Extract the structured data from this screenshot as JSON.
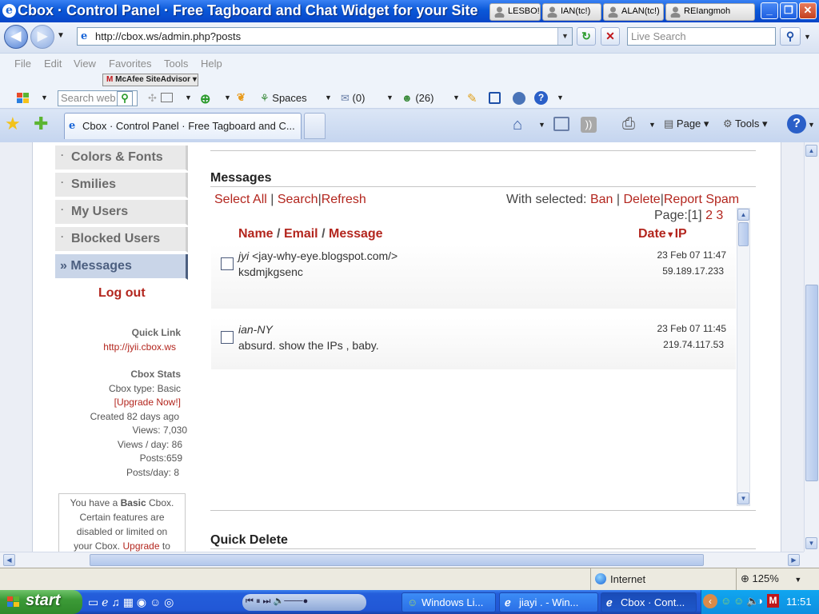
{
  "window": {
    "title": "Cbox · Control Panel · Free Tagboard and Chat Widget for your Site",
    "msn_tabs": [
      "LESBO!",
      "IAN(tc!)",
      "ALAN(tc!)",
      "REIangmoh"
    ]
  },
  "address": {
    "url": "http://cbox.ws/admin.php?posts",
    "search_placeholder": "Live Search"
  },
  "menu": [
    "File",
    "Edit",
    "View",
    "Favorites",
    "Tools",
    "Help"
  ],
  "mcafee": {
    "m": "M",
    "label": "McAfee SiteAdvisor"
  },
  "toolbar": {
    "search_placeholder": "Search web",
    "spaces": "Spaces",
    "mail_count": "(0)",
    "contacts_count": "(26)"
  },
  "tabs": {
    "active_title": "Cbox · Control Panel · Free Tagboard and C...",
    "page_label": "Page",
    "tools_label": "Tools"
  },
  "sidebar": {
    "items": [
      {
        "label": "Colors & Fonts"
      },
      {
        "label": "Smilies"
      },
      {
        "label": "My Users"
      },
      {
        "label": "Blocked Users"
      },
      {
        "label": "» Messages"
      }
    ],
    "logout": "Log out",
    "quick_link_title": "Quick Link",
    "quick_link_url": "http://jyii.cbox.ws",
    "stats_title": "Cbox Stats",
    "cbox_type": "Cbox type: Basic",
    "upgrade": "[Upgrade Now!]",
    "created": "Created 82 days ago",
    "views": "Views: 7,030",
    "views_per_day": "Views / day: 86",
    "posts": "Posts:659",
    "posts_per_day": "Posts/day: 8",
    "upgrade_box": {
      "line1a": "You have a",
      "line1b": "Basic",
      "line1c": "Cbox.",
      "line2": "Certain features are",
      "line3": "disabled or limited on",
      "line4a": "your Cbox.",
      "line4b": "Upgrade",
      "line4c": "to"
    }
  },
  "messages": {
    "heading": "Messages",
    "select_all": "Select All",
    "search": "Search",
    "refresh": "Refresh",
    "with_selected": "With selected:",
    "ban": "Ban",
    "delete": "Delete",
    "report_spam": "Report Spam",
    "page_label": "Page:",
    "current_page": "[1]",
    "page2": "2",
    "page3": "3",
    "col_name": "Name",
    "col_email": "Email",
    "col_message": "Message",
    "col_date": "Date",
    "col_ip": "IP",
    "sep": "/",
    "rows": [
      {
        "name": "jyi",
        "email": "<jay-why-eye.blogspot.com/>",
        "message": "ksdmjkgsenc",
        "date": "23 Feb 07 11:47",
        "ip": "59.189.17.233"
      },
      {
        "name": "ian-NY",
        "email": "",
        "message": "absurd. show the IPs , baby.",
        "date": "23 Feb 07 11:45",
        "ip": "219.74.117.53"
      }
    ],
    "quick_delete": "Quick Delete"
  },
  "status": {
    "zone": "Internet",
    "zoom": "125%"
  },
  "taskbar": {
    "start": "start",
    "buttons": [
      "Windows Li...",
      "jiayi . - Win...",
      "Cbox · Cont..."
    ],
    "clock": "11:51"
  },
  "colors": {
    "accent_red": "#b3261e",
    "xp_blue": "#245edb",
    "active_nav": "#c9d5e8"
  }
}
